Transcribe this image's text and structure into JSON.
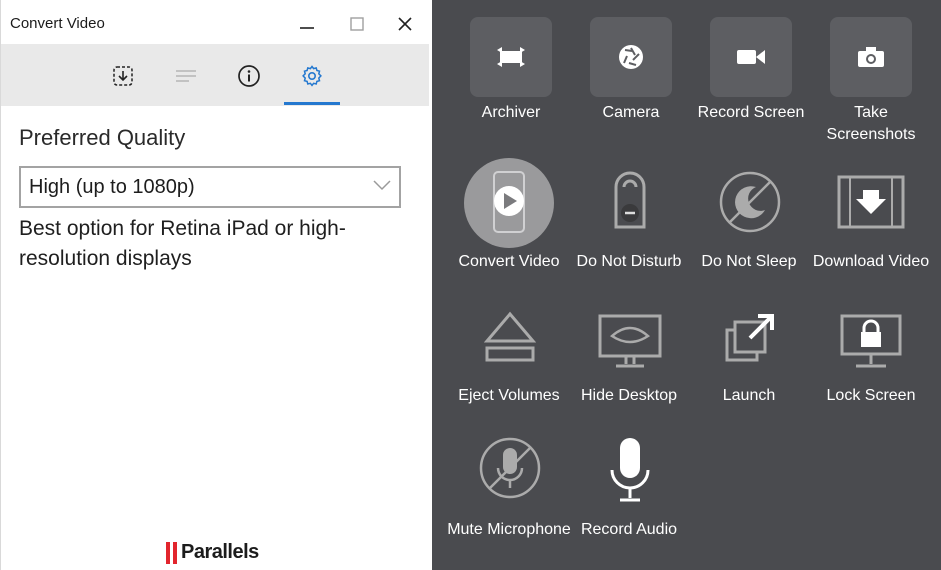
{
  "window": {
    "title": "Convert Video",
    "minimize_glyph": "—",
    "maximize_glyph": "☐",
    "close_glyph": "✕"
  },
  "toolbar": {
    "tabs": [
      {
        "name": "download-icon",
        "active": false
      },
      {
        "name": "list-icon",
        "active": false
      },
      {
        "name": "info-icon",
        "active": false
      },
      {
        "name": "gear-icon",
        "active": true
      }
    ],
    "accent_color": "#2478cf"
  },
  "settings": {
    "label": "Preferred Quality",
    "quality_value": "High (up to 1080p)",
    "description": "Best option for Retina iPad or high-resolution displays"
  },
  "brand": {
    "name": "Parallels",
    "color": "#e2252d"
  },
  "tools": [
    {
      "label": "Archiver",
      "icon": "archiver-icon"
    },
    {
      "label": "Camera",
      "icon": "camera-shutter-icon"
    },
    {
      "label": "Record Screen",
      "icon": "video-camera-icon"
    },
    {
      "label": "Take Screenshots",
      "icon": "photo-camera-icon"
    },
    {
      "label": "Convert Video",
      "icon": "convert-video-icon",
      "selected": true
    },
    {
      "label": "Do Not Disturb",
      "icon": "do-not-disturb-icon"
    },
    {
      "label": "Do Not Sleep",
      "icon": "do-not-sleep-icon"
    },
    {
      "label": "Download Video",
      "icon": "download-video-icon"
    },
    {
      "label": "Eject Volumes",
      "icon": "eject-icon"
    },
    {
      "label": "Hide Desktop",
      "icon": "hide-desktop-icon"
    },
    {
      "label": "Launch",
      "icon": "launch-icon"
    },
    {
      "label": "Lock Screen",
      "icon": "lock-screen-icon"
    },
    {
      "label": "Mute Microphone",
      "icon": "mute-microphone-icon"
    },
    {
      "label": "Record Audio",
      "icon": "microphone-icon"
    }
  ]
}
